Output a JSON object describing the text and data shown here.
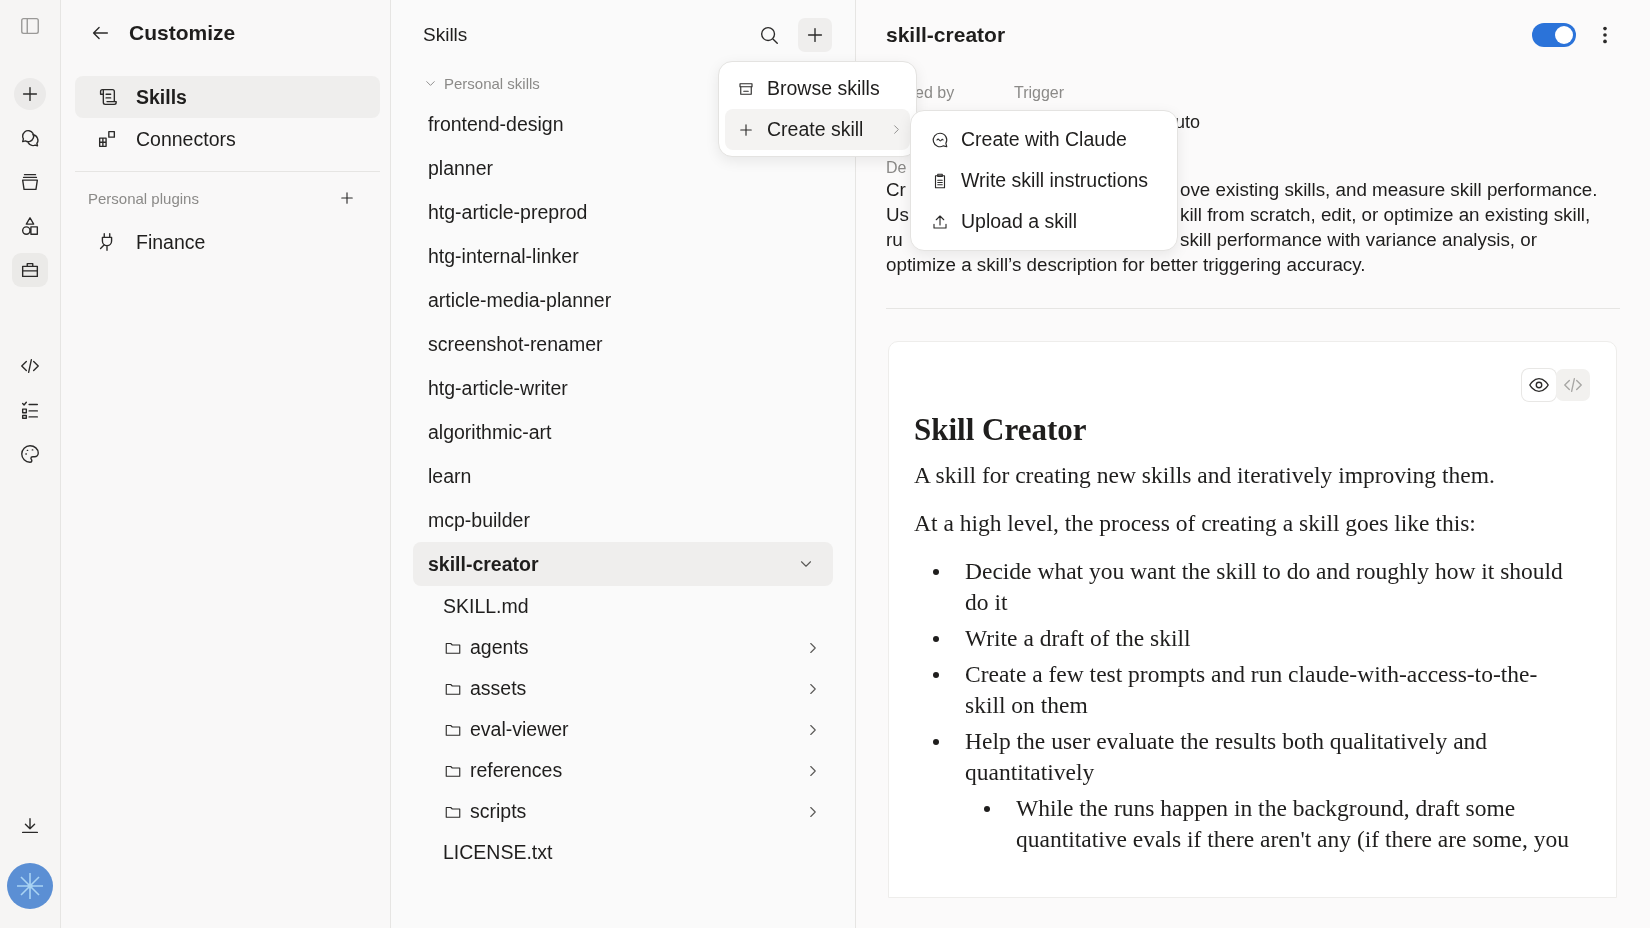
{
  "rail": {
    "top": [
      {
        "kind": "sidebar",
        "selected": false
      }
    ],
    "main": [
      {
        "kind": "new",
        "selected": false
      },
      {
        "kind": "chats",
        "selected": false
      },
      {
        "kind": "projects",
        "selected": false
      },
      {
        "kind": "artifacts",
        "selected": false
      },
      {
        "kind": "customize",
        "selected": true
      }
    ],
    "tools": [
      {
        "kind": "code",
        "selected": false
      },
      {
        "kind": "tasks",
        "selected": false
      },
      {
        "kind": "palette",
        "selected": false
      }
    ],
    "bottom": [
      {
        "kind": "download",
        "selected": false
      }
    ]
  },
  "customize": {
    "title": "Customize",
    "nav": [
      {
        "kind": "skills",
        "label": "Skills",
        "selected": true
      },
      {
        "kind": "connectors",
        "label": "Connectors",
        "selected": false
      }
    ],
    "plugins_heading": "Personal plugins",
    "plugins": [
      {
        "label": "Finance",
        "selected": false
      }
    ]
  },
  "skills_panel": {
    "title": "Skills",
    "section": {
      "label": "Personal skills",
      "expanded": true
    },
    "items": [
      {
        "label": "frontend-design",
        "selected": false
      },
      {
        "label": "planner",
        "selected": false
      },
      {
        "label": "htg-article-preprod",
        "selected": false
      },
      {
        "label": "htg-internal-linker",
        "selected": false
      },
      {
        "label": "article-media-planner",
        "selected": false
      },
      {
        "label": "screenshot-renamer",
        "selected": false
      },
      {
        "label": "htg-article-writer",
        "selected": false
      },
      {
        "label": "algorithmic-art",
        "selected": false
      },
      {
        "label": "learn",
        "selected": false
      },
      {
        "label": "mcp-builder",
        "selected": false
      },
      {
        "label": "skill-creator",
        "selected": true,
        "expanded": true,
        "children": [
          {
            "kind": "file",
            "label": "SKILL.md"
          },
          {
            "kind": "folder",
            "label": "agents",
            "expanded": false
          },
          {
            "kind": "folder",
            "label": "assets",
            "expanded": false
          },
          {
            "kind": "folder",
            "label": "eval-viewer",
            "expanded": false
          },
          {
            "kind": "folder",
            "label": "references",
            "expanded": false
          },
          {
            "kind": "folder",
            "label": "scripts",
            "expanded": false
          },
          {
            "kind": "file",
            "label": "LICENSE.txt"
          }
        ]
      }
    ]
  },
  "menu": {
    "items": [
      {
        "kind": "browse",
        "label": "Browse skills",
        "selected": false
      },
      {
        "kind": "create",
        "label": "Create skill",
        "selected": true,
        "submenu": true
      }
    ]
  },
  "submenu": {
    "items": [
      {
        "kind": "chat",
        "label": "Create with Claude"
      },
      {
        "kind": "clipboard",
        "label": "Write skill instructions"
      },
      {
        "kind": "upload",
        "label": "Upload a skill"
      }
    ]
  },
  "detail": {
    "title": "skill-creator",
    "enabled": true,
    "meta_labels": [
      "ed by",
      "Trigger"
    ],
    "meta_value": "uto",
    "description_label": "De",
    "description_lines": [
      [
        "Cr",
        "ove existing skills, and measure skill performance."
      ],
      [
        "Us",
        "kill from scratch, edit, or optimize an existing skill,"
      ],
      [
        "ru",
        "skill performance with variance analysis, or"
      ],
      [
        "optimize a skill’s description for better triggering accuracy."
      ]
    ],
    "document": {
      "views": [
        {
          "kind": "preview",
          "selected": true
        },
        {
          "kind": "code",
          "selected": false
        }
      ],
      "heading": "Skill Creator",
      "paragraphs": [
        "A skill for creating new skills and iteratively improving them.",
        "At a high level, the process of creating a skill goes like this:"
      ],
      "bullets": [
        {
          "text": "Decide what you want the skill to do and roughly how it should do it"
        },
        {
          "text": "Write a draft of the skill"
        },
        {
          "text": "Create a few test prompts and run claude-with-access-to-the-skill on them"
        },
        {
          "text": "Help the user evaluate the results both qualitatively and quantitatively",
          "children": [
            {
              "text": "While the runs happen in the background, draft some quantitative evals if there aren't any (if there are some, you"
            }
          ]
        }
      ]
    }
  }
}
